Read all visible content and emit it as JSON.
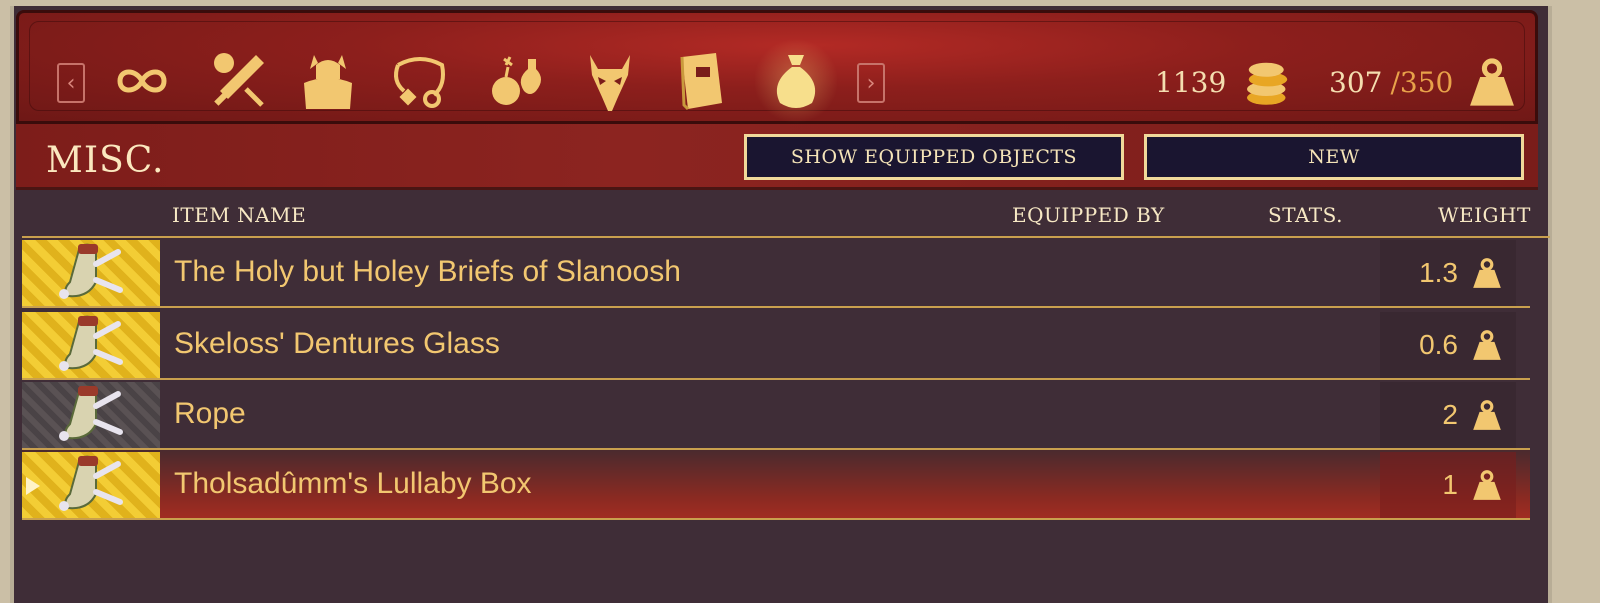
{
  "tabs": [
    {
      "icon": "infinity-icon"
    },
    {
      "icon": "sword-shield-icon"
    },
    {
      "icon": "armor-icon"
    },
    {
      "icon": "jewelry-icon"
    },
    {
      "icon": "bomb-potion-icon"
    },
    {
      "icon": "mask-icon"
    },
    {
      "icon": "book-icon"
    },
    {
      "icon": "bag-icon",
      "active": true
    }
  ],
  "gold": "1139",
  "weight": {
    "current": "307",
    "max": "/350"
  },
  "section": {
    "title": "MISC.",
    "show_equipped_label": "SHOW EQUIPPED OBJECTS",
    "new_label": "NEW"
  },
  "columns": {
    "item_name": "ITEM NAME",
    "equipped_by": "EQUIPPED BY",
    "stats": "STATS.",
    "weight": "WEIGHT"
  },
  "items": [
    {
      "name": "The Holy but Holey Briefs of Slanoosh",
      "weight": "1.3",
      "rarity": "gold"
    },
    {
      "name": "Skeloss' Dentures Glass",
      "weight": "0.6",
      "rarity": "gold"
    },
    {
      "name": "Rope",
      "weight": "2",
      "rarity": "gray"
    },
    {
      "name": "Tholsadûmm's Lullaby Box",
      "weight": "1",
      "rarity": "gold",
      "selected": true
    }
  ],
  "colors": {
    "accent": "#f2c770",
    "bar": "#8d1f1c",
    "panel": "#3f2d37"
  }
}
